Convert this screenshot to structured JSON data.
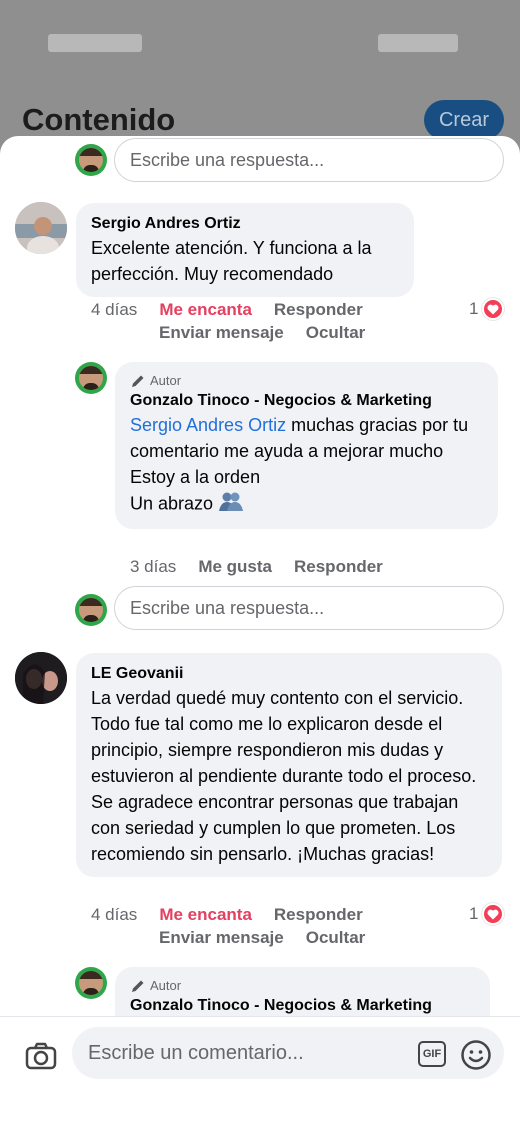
{
  "background": {
    "title": "Contenido",
    "create_button": "Crear"
  },
  "reply_placeholder": "Escribe una respuesta...",
  "comments": [
    {
      "author": "Sergio Andres Ortiz",
      "text": "Excelente atención. Y funciona a la perfección. Muy recomendado",
      "time": "4 días",
      "reaction_label": "Me encanta",
      "reply_label": "Responder",
      "message_label": "Enviar mensaje",
      "hide_label": "Ocultar",
      "reaction_count": "1",
      "reply": {
        "badge": "Autor",
        "author": "Gonzalo Tinoco - Negocios & Marketing",
        "mention": "Sergio Andres Ortiz",
        "text_line1": " muchas gracias por tu comentario me ayuda a mejorar mucho",
        "text_line2": "Estoy a la orden",
        "text_line3": "Un abrazo",
        "time": "3 días",
        "like_label": "Me gusta",
        "reply_label": "Responder"
      }
    },
    {
      "author": "LE Geovanii",
      "text": "La verdad quedé muy contento con el servicio. Todo fue tal como me lo explicaron desde el principio, siempre respondieron mis dudas y estuvieron al pendiente durante todo el proceso. Se agradece encontrar personas que trabajan con seriedad y cumplen lo que prometen. Los recomiendo sin pensarlo. ¡Muchas gracias!",
      "time": "4 días",
      "reaction_label": "Me encanta",
      "reply_label": "Responder",
      "message_label": "Enviar mensaje",
      "hide_label": "Ocultar",
      "reaction_count": "1",
      "reply": {
        "badge": "Autor",
        "author": "Gonzalo Tinoco - Negocios & Marketing"
      }
    }
  ],
  "composer": {
    "placeholder": "Escribe un comentario...",
    "gif_label": "GIF"
  },
  "colors": {
    "accent_love": "#e4405f",
    "link": "#216fdb",
    "create_button": "#184e82"
  },
  "icons": [
    "camera-icon",
    "gif-icon",
    "emoji-icon",
    "pencil-icon",
    "heart-icon",
    "hug-emoji-icon"
  ]
}
